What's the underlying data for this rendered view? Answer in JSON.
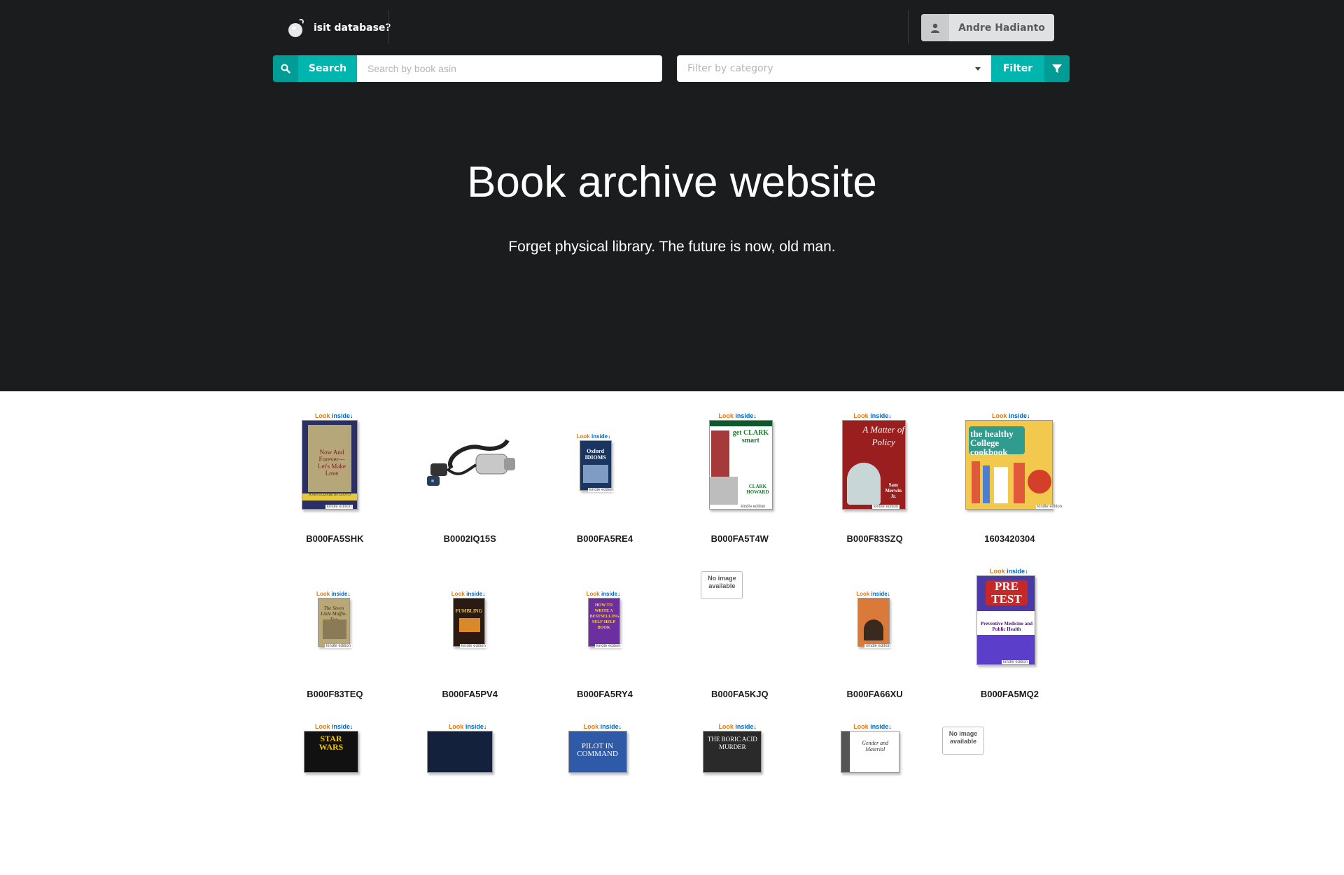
{
  "menu": {
    "brand": "isit database?",
    "user": "Andre Hadianto"
  },
  "search": {
    "button_label": "Search",
    "placeholder": "Search by book asin"
  },
  "filter": {
    "placeholder": "Filter by category",
    "button_label": "Filter"
  },
  "hero": {
    "title": "Book archive website",
    "subtitle": "Forget physical library. The future is now, old man."
  },
  "look_inside": {
    "look": "Look",
    "inside": "inside"
  },
  "kindle_badge": "kindle edition",
  "no_image_text": "No image available",
  "books": [
    {
      "asin": "B000FA5SHK",
      "cover_text": "Now And Forever— Let's Make Love",
      "author": "JOAN ELIZABETH LLOYD"
    },
    {
      "asin": "B0002IQ15S",
      "cover_text": "",
      "author": ""
    },
    {
      "asin": "B000FA5RE4",
      "cover_text": "Oxford IDIOMS",
      "author": ""
    },
    {
      "asin": "B000FA5T4W",
      "cover_text": "get CLARK smart",
      "author": "CLARK HOWARD"
    },
    {
      "asin": "B000F83SZQ",
      "cover_text": "A Matter of Policy",
      "author": "Sam Merwin Jr."
    },
    {
      "asin": "1603420304",
      "cover_text": "the healthy College cookbook",
      "author": ""
    },
    {
      "asin": "B000F83TEQ",
      "cover_text": "The Seven Little Muffin-Eye",
      "author": ""
    },
    {
      "asin": "B000FA5PV4",
      "cover_text": "FUMBLING",
      "author": ""
    },
    {
      "asin": "B000FA5RY4",
      "cover_text": "HOW TO WRITE A BESTSELLING SELF-HELP BOOK",
      "author": ""
    },
    {
      "asin": "B000FA5KJQ",
      "cover_text": "",
      "author": ""
    },
    {
      "asin": "B000FA66XU",
      "cover_text": "",
      "author": ""
    },
    {
      "asin": "B000FA5MQ2",
      "cover_text": "PRE TEST",
      "author": "Preventive Medicine and Public Health"
    }
  ],
  "partial_books": [
    {
      "cover_text": "STAR WARS"
    },
    {
      "cover_text": ""
    },
    {
      "cover_text": "PILOT IN COMMAND"
    },
    {
      "cover_text": "THE BORIC ACID MURDER"
    },
    {
      "cover_text": "Gender and Material"
    },
    {
      "cover_text": ""
    }
  ],
  "colors": {
    "hero_bg": "#1b1c1d",
    "teal": "#00b5ad",
    "teal_dark": "#009c95"
  }
}
